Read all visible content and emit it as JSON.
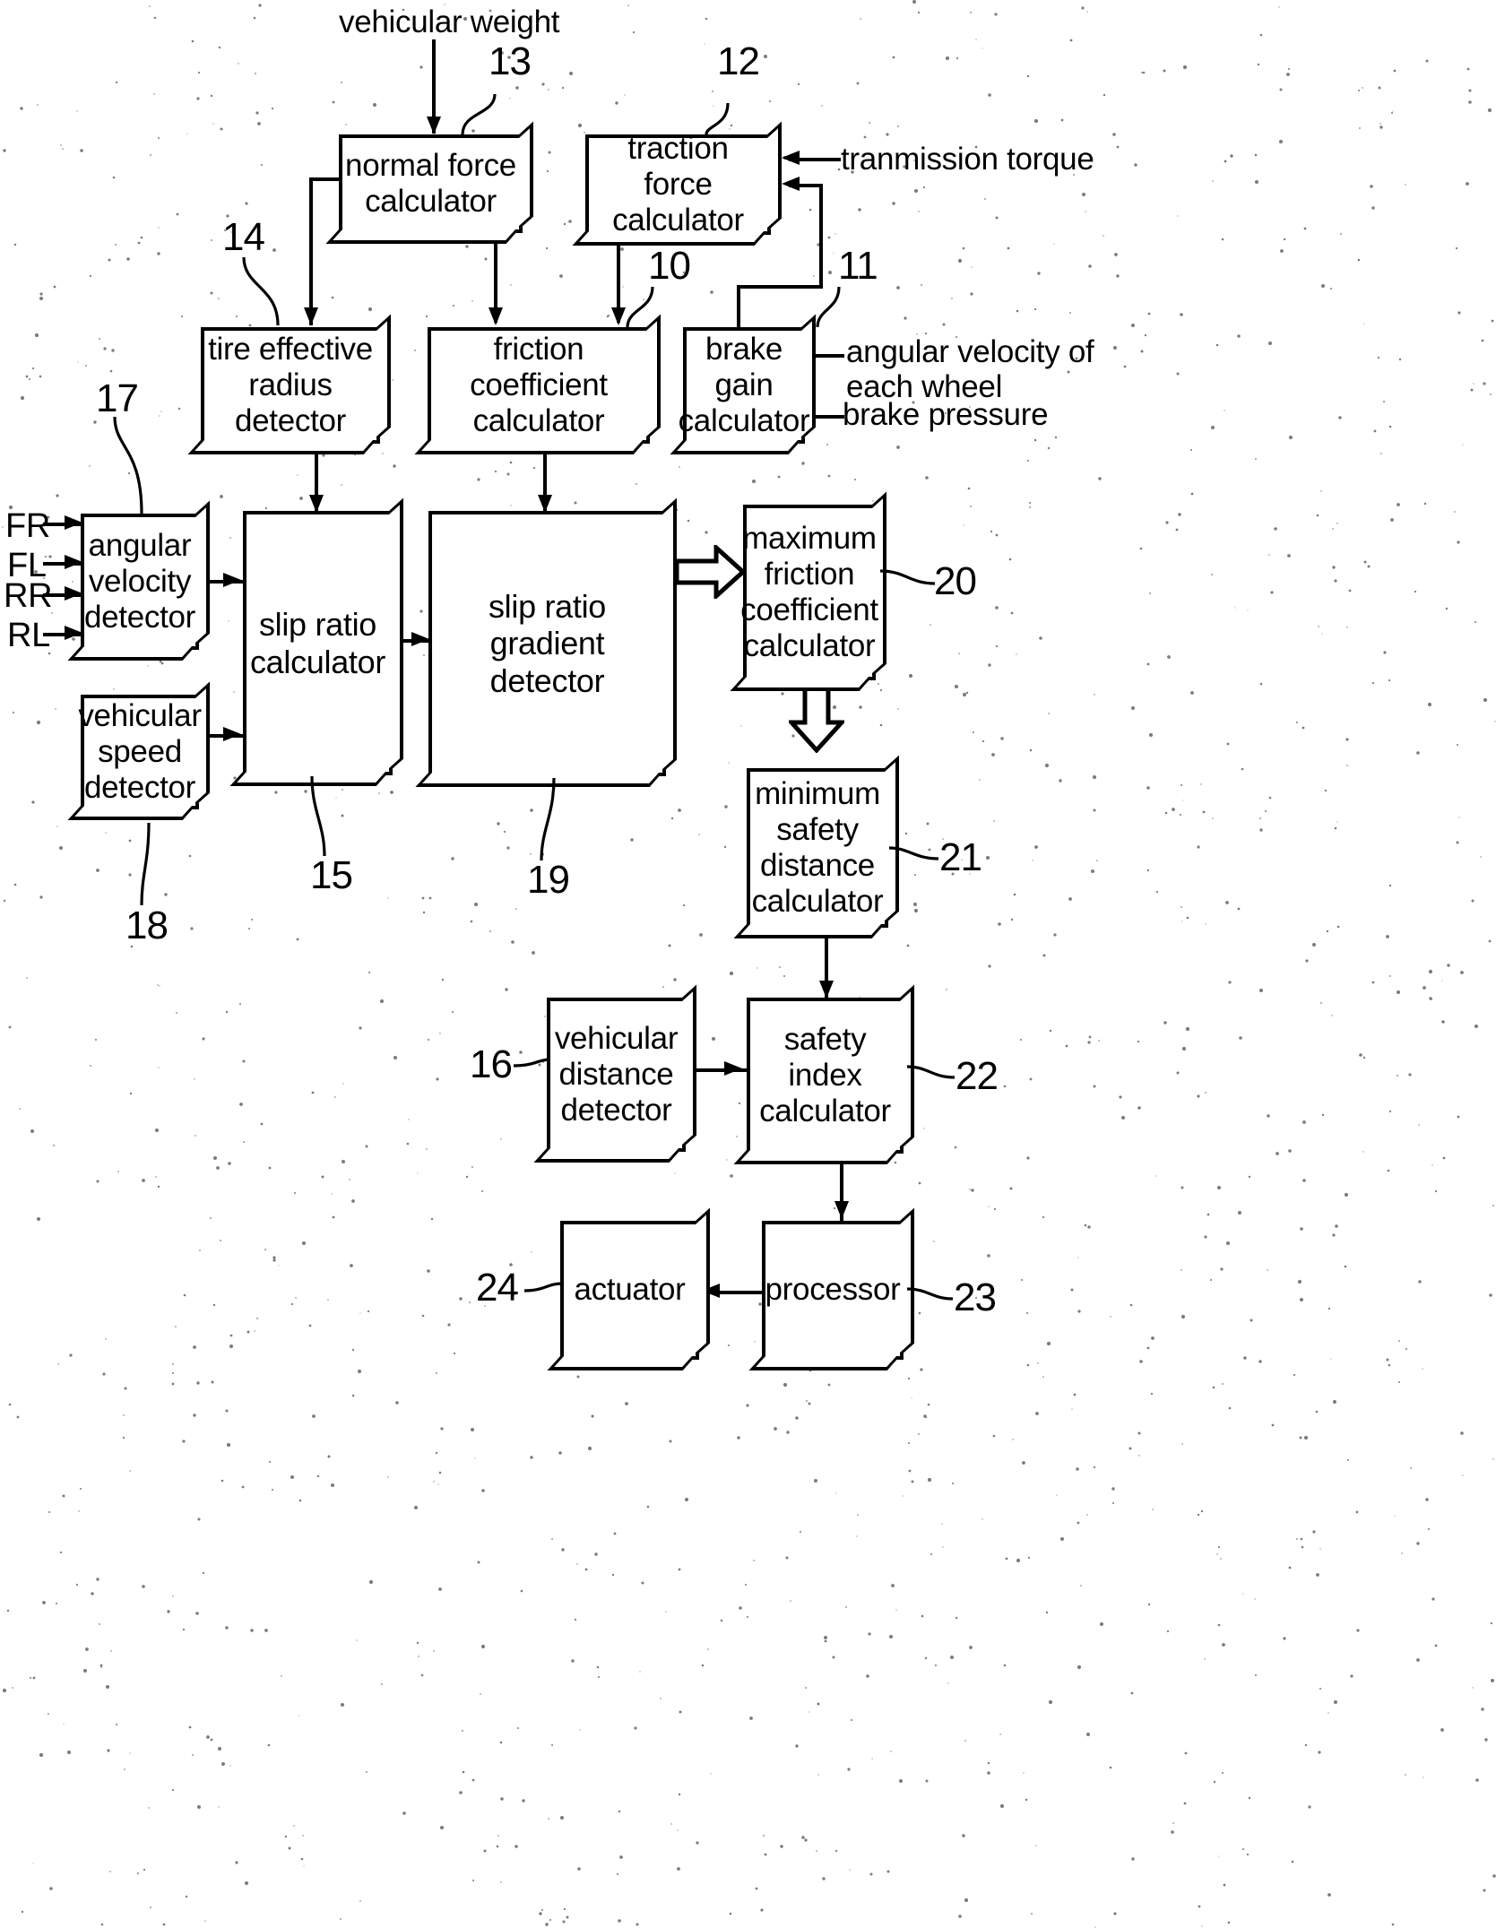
{
  "figure": {
    "type": "patent-block-diagram",
    "title": "vehicle braking safety block diagram"
  },
  "external_labels": {
    "vehicular_weight": "vehicular weight",
    "transmission_torque": "tranmission torque",
    "angular_velocity_each_wheel": "angular velocity of\neach wheel",
    "brake_pressure": "brake pressure",
    "wheel_fr": "FR",
    "wheel_fl": "FL",
    "wheel_rr": "RR",
    "wheel_rl": "RL"
  },
  "blocks": [
    {
      "id": "normal_force",
      "label": "normal force\ncalculator",
      "ref": "13"
    },
    {
      "id": "traction_force",
      "label": "traction force\ncalculator",
      "ref": "12"
    },
    {
      "id": "tire_radius",
      "label": "tire effective\nradius detector",
      "ref": "14"
    },
    {
      "id": "friction_coeff",
      "label": "friction coefficient\ncalculator",
      "ref": "10"
    },
    {
      "id": "brake_gain",
      "label": "brake\ngain\ncalculator",
      "ref": "11"
    },
    {
      "id": "angular_velocity",
      "label": "angular\nvelocity\ndetector",
      "ref": "17"
    },
    {
      "id": "vehicular_speed",
      "label": "vehicular\nspeed\ndetector",
      "ref": "18"
    },
    {
      "id": "slip_ratio",
      "label": "slip ratio\ncalculator",
      "ref": "15"
    },
    {
      "id": "slip_gradient",
      "label": "slip ratio\ngradient detector",
      "ref": "19"
    },
    {
      "id": "max_friction",
      "label": "maximum\nfriction\ncoefficient\ncalculator",
      "ref": "20"
    },
    {
      "id": "min_safety",
      "label": "minimum\nsafety\ndistance\ncalculator",
      "ref": "21"
    },
    {
      "id": "vehicular_distance",
      "label": "vehicular\ndistance\ndetector",
      "ref": "16"
    },
    {
      "id": "safety_index",
      "label": "safety index\ncalculator",
      "ref": "22"
    },
    {
      "id": "processor",
      "label": "processor",
      "ref": "23"
    },
    {
      "id": "actuator",
      "label": "actuator",
      "ref": "24"
    }
  ],
  "reference_numbers": {
    "n10": "10",
    "n11": "11",
    "n12": "12",
    "n13": "13",
    "n14": "14",
    "n15": "15",
    "n16": "16",
    "n17": "17",
    "n18": "18",
    "n19": "19",
    "n20": "20",
    "n21": "21",
    "n22": "22",
    "n23": "23",
    "n24": "24"
  },
  "colors": {
    "ink": "#000000",
    "paper": "#ffffff"
  }
}
